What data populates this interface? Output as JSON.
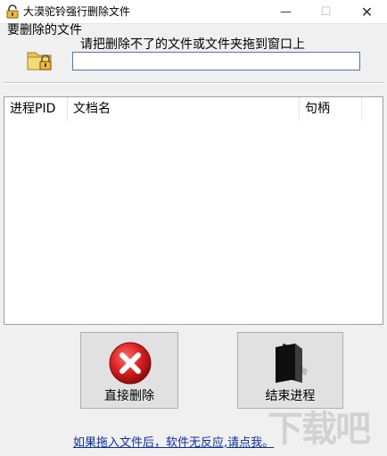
{
  "window": {
    "title": "大漠驼铃强行删除文件",
    "minimize": "—",
    "maximize": "☐",
    "close": "✕"
  },
  "target": {
    "group_label": "要删除的文件",
    "hint": "请把删除不了的文件或文件夹拖到窗口上",
    "path_value": ""
  },
  "process_list": {
    "columns": [
      "进程PID",
      "文档名",
      "句柄"
    ],
    "rows": []
  },
  "buttons": {
    "delete_label": "直接删除",
    "end_process_label": "结束进程"
  },
  "help_link": "如果拖入文件后，软件无反应,请点我。",
  "watermark_text": "下载吧",
  "icons": {
    "title": "padlock-icon",
    "folder": "locked-folder-icon",
    "delete": "red-x-icon",
    "end_process": "black-book-icon"
  },
  "colors": {
    "accent_border": "#4a7ab8",
    "link": "#0b2ea8",
    "delete_red": "#d81e1e"
  }
}
